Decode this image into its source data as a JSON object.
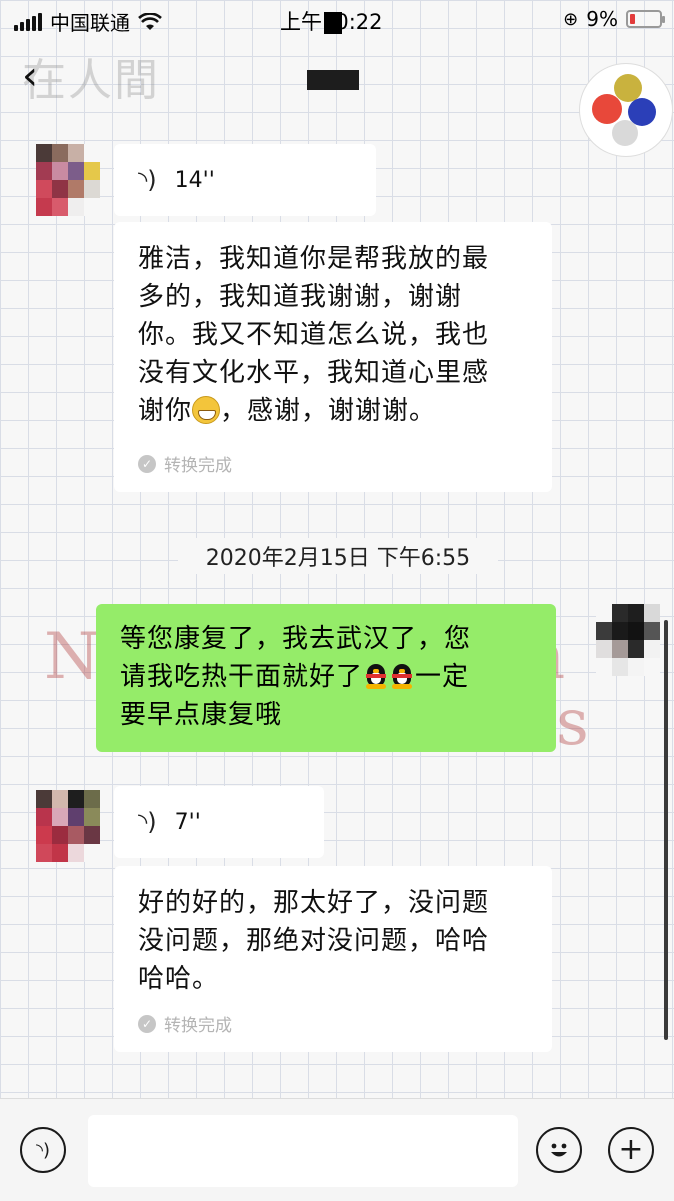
{
  "status_bar": {
    "carrier": "中国联通",
    "time": "上午10:22",
    "battery": "9%"
  },
  "nav": {
    "back_glyph": "‹",
    "watermark": "在人間"
  },
  "messages": {
    "voice1": {
      "duration": "14''"
    },
    "text1": {
      "lines": [
        "雅洁，我知道你是帮我放的最",
        "多的，我知道我谢谢，谢谢",
        "你。我又不知道怎么说，我也",
        "没有文化水平，我知道心里感"
      ],
      "last_pre": "谢你",
      "last_post": "，感谢，谢谢谢。",
      "status": "转换完成"
    },
    "timestamp": "2020年2月15日 下午6:55",
    "sent": {
      "line1": "等您康复了，我去武汉了，您",
      "line2_pre": "请我吃热干面就好了",
      "line2_post": "一定",
      "line3": "要早点康复哦"
    },
    "voice2": {
      "duration": "7''"
    },
    "text2": {
      "lines": [
        "好的好的，那太好了，没问题",
        "没问题，那绝对没问题，哈哈",
        "哈哈。"
      ],
      "status": "转换完成"
    }
  },
  "background_letters": [
    "N",
    "h",
    "s"
  ],
  "icons": [
    "signal-icon",
    "wifi-icon",
    "battery-icon",
    "voice-icon",
    "check-icon",
    "emoji-icon",
    "plus-icon",
    "penguin-emoji",
    "grin-emoji"
  ]
}
